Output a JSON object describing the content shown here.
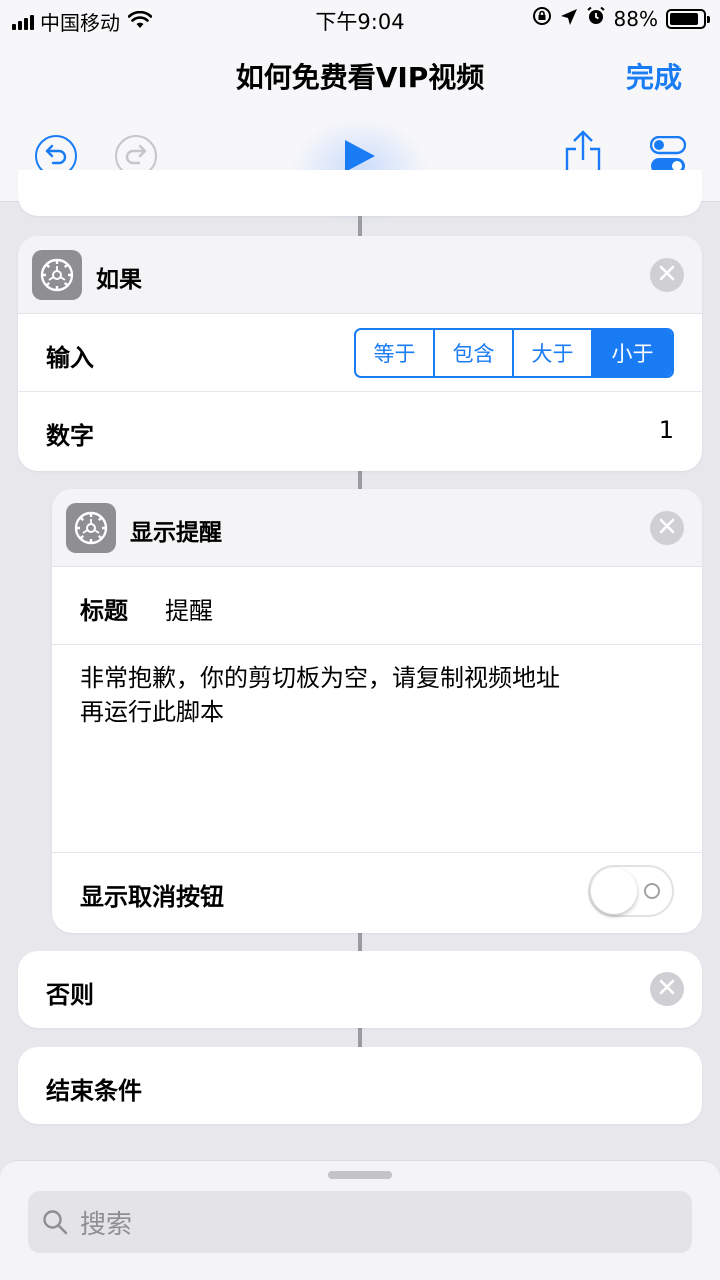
{
  "status_bar": {
    "carrier": "中国移动",
    "time": "下午9:04",
    "battery": "88%"
  },
  "header": {
    "title": "如何免费看VIP视频",
    "done_label": "完成"
  },
  "if_block": {
    "title": "如果",
    "input_label": "输入",
    "options": [
      "等于",
      "包含",
      "大于",
      "小于"
    ],
    "selected_option": "小于",
    "number_label": "数字",
    "number_value": "1"
  },
  "alert_block": {
    "title": "显示提醒",
    "title_label": "标题",
    "title_value": "提醒",
    "message_line1": "非常抱歉，你的剪切板为空，请复制视频地址",
    "message_line2": "再运行此脚本",
    "cancel_label": "显示取消按钮",
    "cancel_enabled": false
  },
  "otherwise_block": {
    "title": "否则"
  },
  "end_block": {
    "title": "结束条件"
  },
  "search": {
    "placeholder": "搜索"
  },
  "colors": {
    "accent": "#1a7cf5",
    "background": "#e7e7ec"
  }
}
